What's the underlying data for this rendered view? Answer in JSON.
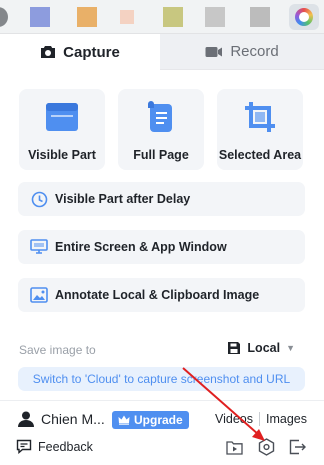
{
  "tabs": {
    "capture": "Capture",
    "record": "Record"
  },
  "cards": [
    {
      "label": "Visible Part",
      "icon": "browser-window-icon"
    },
    {
      "label": "Full Page",
      "icon": "scroll-page-icon"
    },
    {
      "label": "Selected Area",
      "icon": "crop-icon"
    }
  ],
  "rows": [
    {
      "label": "Visible Part after Delay",
      "icon": "timer-icon"
    },
    {
      "label": "Entire Screen & App Window",
      "icon": "monitor-icon"
    },
    {
      "label": "Annotate Local & Clipboard Image",
      "icon": "image-icon"
    }
  ],
  "save": {
    "label": "Save image to",
    "value": "Local"
  },
  "cloud_hint": "Switch to 'Cloud' to capture screenshot and URL",
  "footer": {
    "user_name": "Chien M...",
    "upgrade": "Upgrade",
    "videos": "Videos",
    "images": "Images",
    "feedback": "Feedback"
  },
  "colors": {
    "accent": "#4f8ff0",
    "card_bg": "#f3f5f8",
    "annotation_arrow": "#e02020"
  }
}
